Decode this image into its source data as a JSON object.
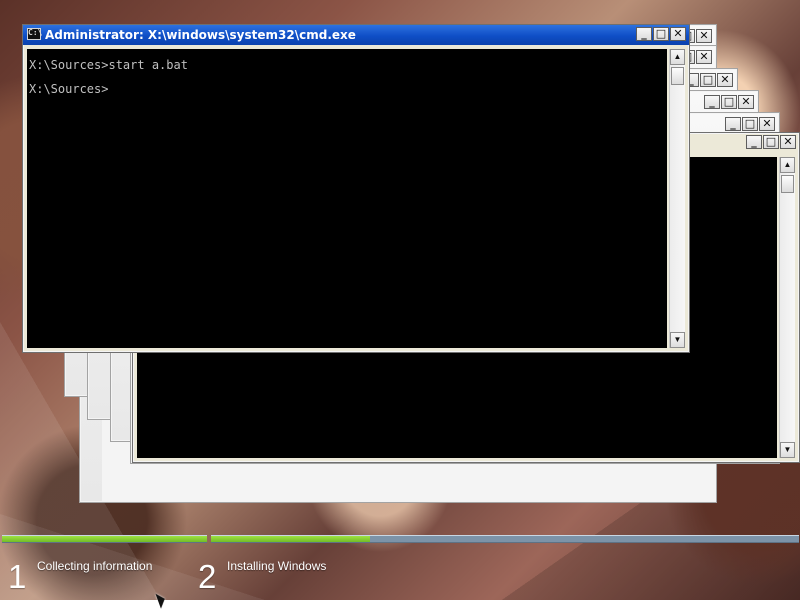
{
  "window_title": "Administrator: X:\\windows\\system32\\cmd.exe",
  "console_lines": [
    "X:\\Sources>start a.bat",
    "X:\\Sources>"
  ],
  "controls": {
    "minimize": "_",
    "maximize": "□",
    "close": "✕"
  },
  "scroll_icons": {
    "up": "▲",
    "down": "▼"
  },
  "cmd_icon": "C:\\",
  "stages": [
    {
      "number": "1",
      "label": "Collecting information",
      "progress_fraction": 1.0
    },
    {
      "number": "2",
      "label": "Installing Windows",
      "progress_fraction": 0.27
    }
  ],
  "colors": {
    "title_bar_blue": "#0f4ec6",
    "console_bg": "#000000",
    "console_text": "#c0c0c0",
    "progress_green": "#8fd23a",
    "progress_blue_gray": "#7c93a8"
  },
  "icons": {
    "cmd": "cmd-icon",
    "minimize": "minimize-icon",
    "maximize": "maximize-icon",
    "close": "close-icon",
    "scroll_up": "scroll-up-icon",
    "scroll_down": "scroll-down-icon",
    "mouse_pointer": "mouse-pointer-icon"
  }
}
